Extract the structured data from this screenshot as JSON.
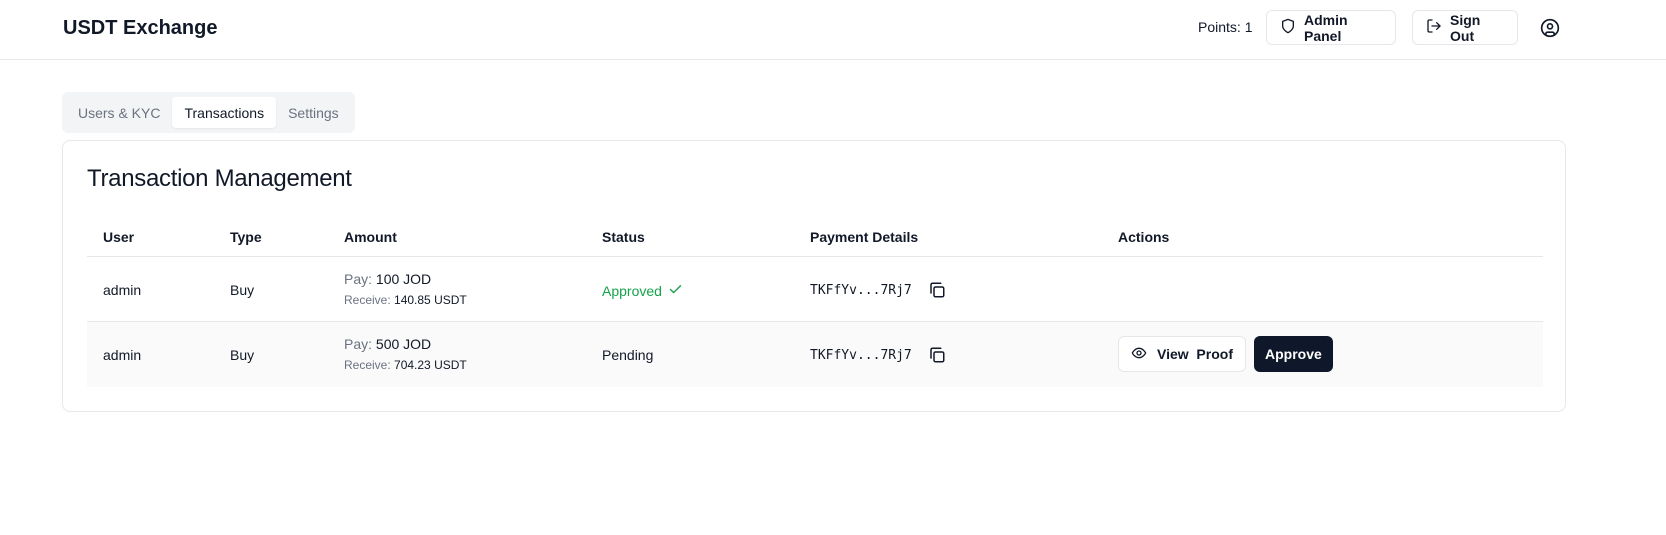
{
  "header": {
    "brand": "USDT Exchange",
    "points": "Points: 1",
    "admin_panel": "Admin Panel",
    "sign_out": "Sign Out"
  },
  "tabs": [
    {
      "label": "Users & KYC",
      "active": false
    },
    {
      "label": "Transactions",
      "active": true
    },
    {
      "label": "Settings",
      "active": false
    }
  ],
  "card": {
    "title": "Transaction Management"
  },
  "table": {
    "columns": [
      "User",
      "Type",
      "Amount",
      "Status",
      "Payment Details",
      "Actions"
    ],
    "rows": [
      {
        "user": "admin",
        "type": "Buy",
        "pay_label": "Pay:",
        "pay": "100 JOD",
        "receive_label": "Receive:",
        "receive": "140.85 USDT",
        "status": "Approved",
        "address": "TKFfYv...7Rj7"
      },
      {
        "user": "admin",
        "type": "Buy",
        "pay_label": "Pay:",
        "pay": "500 JOD",
        "receive_label": "Receive:",
        "receive": "704.23 USDT",
        "status": "Pending",
        "address": "TKFfYv...7Rj7",
        "view_proof": "View  Proof",
        "approve": "Approve"
      }
    ]
  },
  "colors": {
    "approved": "#16a34a",
    "primary_button": "#0f172a",
    "border": "#e5e7eb"
  },
  "icons": {
    "admin": "shield-icon",
    "sign_out": "logout-icon",
    "user": "user-circle-icon",
    "copy": "copy-icon",
    "check": "check-icon",
    "view": "eye-icon"
  }
}
